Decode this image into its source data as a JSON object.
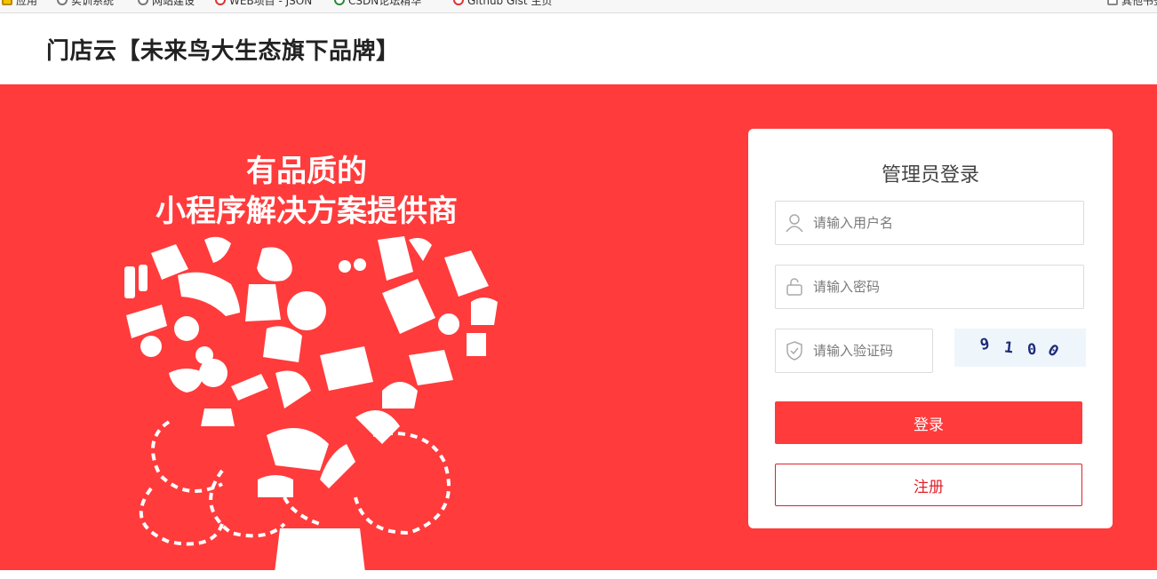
{
  "bookmarks": [
    {
      "label": "应用",
      "icon": "apps-icon"
    },
    {
      "label": "实训系统",
      "icon": "globe-icon"
    },
    {
      "label": "网站建设",
      "icon": "globe-icon"
    },
    {
      "label": "WEB项目 - JSON",
      "icon": "red-dot-icon"
    },
    {
      "label": "CSDN论坛精华",
      "icon": "leaf-icon"
    },
    {
      "label": "Github Gist 主页",
      "icon": "red-dot-icon"
    },
    {
      "label": "其他书签",
      "icon": "folder-icon"
    }
  ],
  "header": {
    "title": "门店云【未来鸟大生态旗下品牌】"
  },
  "banner": {
    "slogan_line1": "有品质的",
    "slogan_line2": "小程序解决方案提供商",
    "background_color": "#ff3b3c"
  },
  "login": {
    "title": "管理员登录",
    "username_placeholder": "请输入用户名",
    "password_placeholder": "请输入密码",
    "captcha_placeholder": "请输入验证码",
    "captcha_chars": [
      "9",
      "1",
      "0",
      "0"
    ],
    "login_label": "登录",
    "register_label": "注册",
    "accent_color": "#ff3b3c"
  }
}
